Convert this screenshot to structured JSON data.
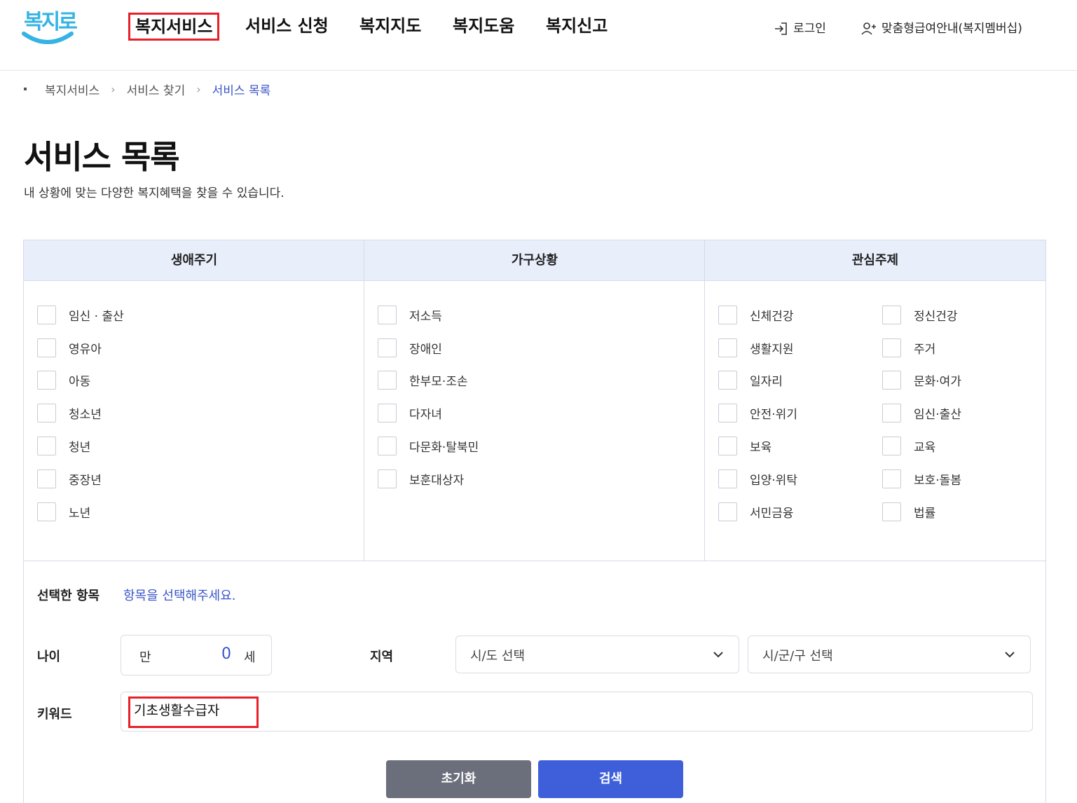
{
  "logo": {
    "text": "복지로",
    "color": "#35b3e3"
  },
  "gnb": [
    {
      "label": "복지서비스",
      "active": true
    },
    {
      "label": "서비스 신청"
    },
    {
      "label": "복지지도"
    },
    {
      "label": "복지도움"
    },
    {
      "label": "복지신고"
    }
  ],
  "util": {
    "login": {
      "label": "로그인",
      "icon": "login-icon"
    },
    "membership": {
      "label": "맞춤형급여안내(복지멤버십)",
      "icon": "user-add-icon"
    }
  },
  "breadcrumb": [
    "복지서비스",
    "서비스 찾기",
    "서비스 목록"
  ],
  "page": {
    "title": "서비스 목록",
    "description": "내 상황에 맞는 다양한 복지혜택을 찾을 수 있습니다."
  },
  "filters": {
    "lifecycle": {
      "title": "생애주기",
      "options": [
        "임신 · 출산",
        "영유아",
        "아동",
        "청소년",
        "청년",
        "중장년",
        "노년"
      ]
    },
    "household": {
      "title": "가구상황",
      "options": [
        "저소득",
        "장애인",
        "한부모·조손",
        "다자녀",
        "다문화·탈북민",
        "보훈대상자"
      ]
    },
    "interest": {
      "title": "관심주제",
      "left": [
        "신체건강",
        "생활지원",
        "일자리",
        "안전·위기",
        "보육",
        "입양·위탁",
        "서민금융"
      ],
      "right": [
        "정신건강",
        "주거",
        "문화·여가",
        "임신·출산",
        "교육",
        "보호·돌봄",
        "법률"
      ]
    }
  },
  "selected": {
    "label": "선택한 항목",
    "value": "항목을 선택해주세요."
  },
  "age": {
    "label": "나이",
    "prefix": "만",
    "value": "0",
    "suffix": "세"
  },
  "region": {
    "label": "지역",
    "sido": "시/도 선택",
    "sigungu": "시/군/구 선택"
  },
  "keyword": {
    "label": "키워드",
    "value": "기초생활수급자"
  },
  "buttons": {
    "reset": "초기화",
    "search": "검색"
  },
  "colors": {
    "accent": "#3a55c8",
    "primary_button": "#3e5fd9",
    "reset_button": "#6b6e7b",
    "highlight": "#e8202a",
    "header_bg": "#e9eefb"
  }
}
